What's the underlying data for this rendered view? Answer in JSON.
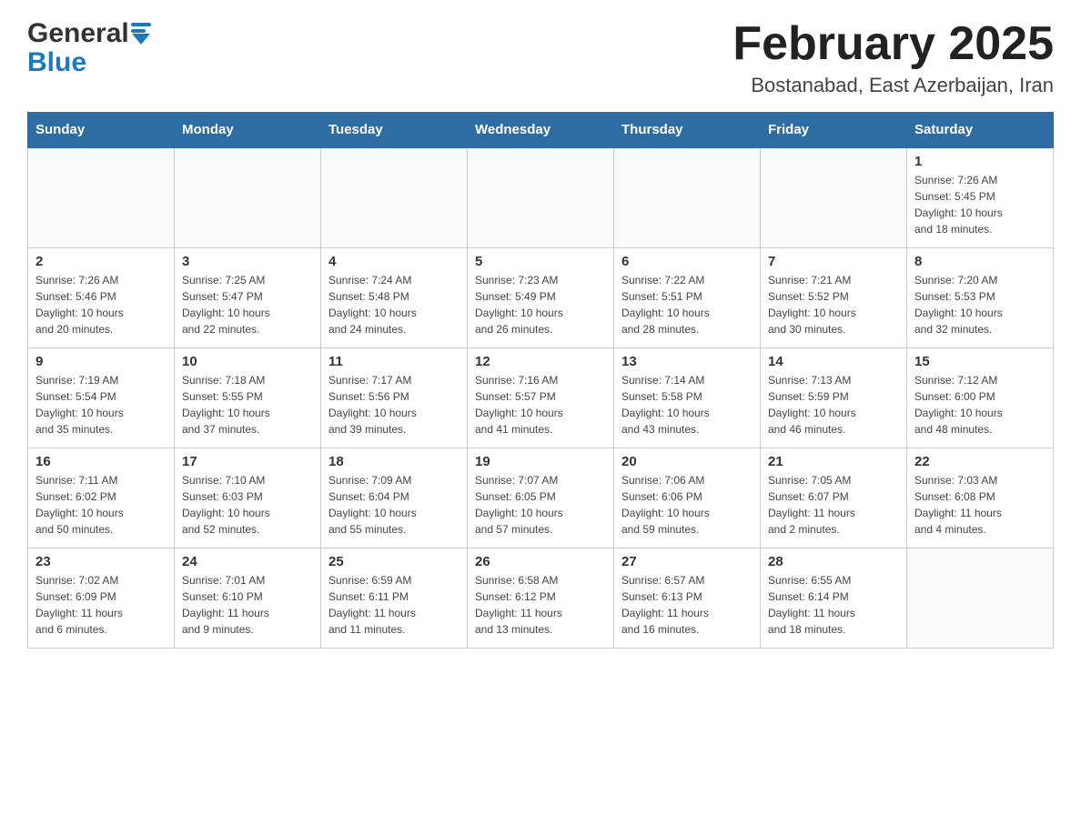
{
  "header": {
    "logo_general": "General",
    "logo_blue": "Blue",
    "month_title": "February 2025",
    "location": "Bostanabad, East Azerbaijan, Iran"
  },
  "weekdays": [
    "Sunday",
    "Monday",
    "Tuesday",
    "Wednesday",
    "Thursday",
    "Friday",
    "Saturday"
  ],
  "weeks": [
    [
      {
        "day": "",
        "info": ""
      },
      {
        "day": "",
        "info": ""
      },
      {
        "day": "",
        "info": ""
      },
      {
        "day": "",
        "info": ""
      },
      {
        "day": "",
        "info": ""
      },
      {
        "day": "",
        "info": ""
      },
      {
        "day": "1",
        "info": "Sunrise: 7:26 AM\nSunset: 5:45 PM\nDaylight: 10 hours\nand 18 minutes."
      }
    ],
    [
      {
        "day": "2",
        "info": "Sunrise: 7:26 AM\nSunset: 5:46 PM\nDaylight: 10 hours\nand 20 minutes."
      },
      {
        "day": "3",
        "info": "Sunrise: 7:25 AM\nSunset: 5:47 PM\nDaylight: 10 hours\nand 22 minutes."
      },
      {
        "day": "4",
        "info": "Sunrise: 7:24 AM\nSunset: 5:48 PM\nDaylight: 10 hours\nand 24 minutes."
      },
      {
        "day": "5",
        "info": "Sunrise: 7:23 AM\nSunset: 5:49 PM\nDaylight: 10 hours\nand 26 minutes."
      },
      {
        "day": "6",
        "info": "Sunrise: 7:22 AM\nSunset: 5:51 PM\nDaylight: 10 hours\nand 28 minutes."
      },
      {
        "day": "7",
        "info": "Sunrise: 7:21 AM\nSunset: 5:52 PM\nDaylight: 10 hours\nand 30 minutes."
      },
      {
        "day": "8",
        "info": "Sunrise: 7:20 AM\nSunset: 5:53 PM\nDaylight: 10 hours\nand 32 minutes."
      }
    ],
    [
      {
        "day": "9",
        "info": "Sunrise: 7:19 AM\nSunset: 5:54 PM\nDaylight: 10 hours\nand 35 minutes."
      },
      {
        "day": "10",
        "info": "Sunrise: 7:18 AM\nSunset: 5:55 PM\nDaylight: 10 hours\nand 37 minutes."
      },
      {
        "day": "11",
        "info": "Sunrise: 7:17 AM\nSunset: 5:56 PM\nDaylight: 10 hours\nand 39 minutes."
      },
      {
        "day": "12",
        "info": "Sunrise: 7:16 AM\nSunset: 5:57 PM\nDaylight: 10 hours\nand 41 minutes."
      },
      {
        "day": "13",
        "info": "Sunrise: 7:14 AM\nSunset: 5:58 PM\nDaylight: 10 hours\nand 43 minutes."
      },
      {
        "day": "14",
        "info": "Sunrise: 7:13 AM\nSunset: 5:59 PM\nDaylight: 10 hours\nand 46 minutes."
      },
      {
        "day": "15",
        "info": "Sunrise: 7:12 AM\nSunset: 6:00 PM\nDaylight: 10 hours\nand 48 minutes."
      }
    ],
    [
      {
        "day": "16",
        "info": "Sunrise: 7:11 AM\nSunset: 6:02 PM\nDaylight: 10 hours\nand 50 minutes."
      },
      {
        "day": "17",
        "info": "Sunrise: 7:10 AM\nSunset: 6:03 PM\nDaylight: 10 hours\nand 52 minutes."
      },
      {
        "day": "18",
        "info": "Sunrise: 7:09 AM\nSunset: 6:04 PM\nDaylight: 10 hours\nand 55 minutes."
      },
      {
        "day": "19",
        "info": "Sunrise: 7:07 AM\nSunset: 6:05 PM\nDaylight: 10 hours\nand 57 minutes."
      },
      {
        "day": "20",
        "info": "Sunrise: 7:06 AM\nSunset: 6:06 PM\nDaylight: 10 hours\nand 59 minutes."
      },
      {
        "day": "21",
        "info": "Sunrise: 7:05 AM\nSunset: 6:07 PM\nDaylight: 11 hours\nand 2 minutes."
      },
      {
        "day": "22",
        "info": "Sunrise: 7:03 AM\nSunset: 6:08 PM\nDaylight: 11 hours\nand 4 minutes."
      }
    ],
    [
      {
        "day": "23",
        "info": "Sunrise: 7:02 AM\nSunset: 6:09 PM\nDaylight: 11 hours\nand 6 minutes."
      },
      {
        "day": "24",
        "info": "Sunrise: 7:01 AM\nSunset: 6:10 PM\nDaylight: 11 hours\nand 9 minutes."
      },
      {
        "day": "25",
        "info": "Sunrise: 6:59 AM\nSunset: 6:11 PM\nDaylight: 11 hours\nand 11 minutes."
      },
      {
        "day": "26",
        "info": "Sunrise: 6:58 AM\nSunset: 6:12 PM\nDaylight: 11 hours\nand 13 minutes."
      },
      {
        "day": "27",
        "info": "Sunrise: 6:57 AM\nSunset: 6:13 PM\nDaylight: 11 hours\nand 16 minutes."
      },
      {
        "day": "28",
        "info": "Sunrise: 6:55 AM\nSunset: 6:14 PM\nDaylight: 11 hours\nand 18 minutes."
      },
      {
        "day": "",
        "info": ""
      }
    ]
  ]
}
